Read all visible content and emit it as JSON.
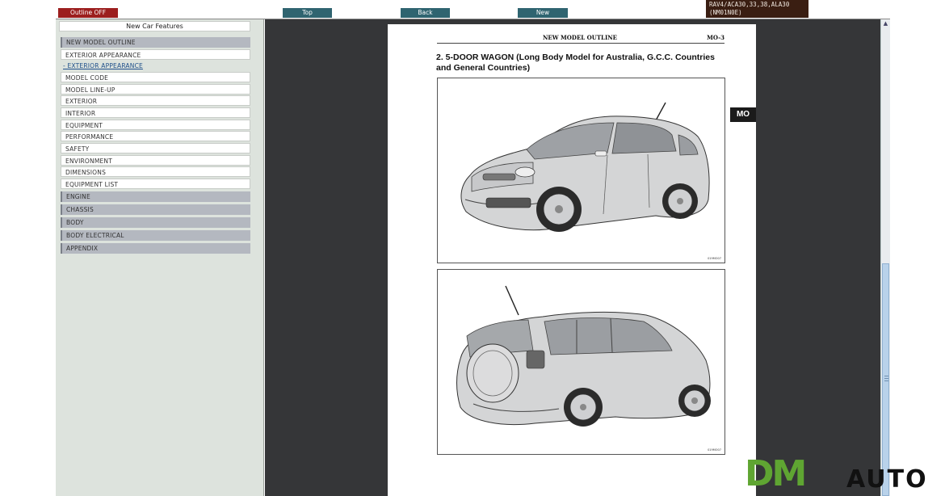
{
  "toolbar": {
    "outline_label": "Outline OFF",
    "top_label": "Top",
    "back_label": "Back",
    "new_label": "New",
    "model_line1": "RAV4/ACA30,33,38,ALA30",
    "model_line2": "(NM01N0E)"
  },
  "sidebar": {
    "header": "New Car Features",
    "items": [
      {
        "label": "NEW MODEL OUTLINE",
        "kind": "section"
      },
      {
        "label": "EXTERIOR APPEARANCE",
        "kind": "sub"
      },
      {
        "label": "- EXTERIOR APPEARANCE",
        "kind": "link"
      },
      {
        "label": "MODEL CODE",
        "kind": "sub"
      },
      {
        "label": "MODEL LINE-UP",
        "kind": "sub"
      },
      {
        "label": "EXTERIOR",
        "kind": "sub"
      },
      {
        "label": "INTERIOR",
        "kind": "sub"
      },
      {
        "label": "EQUIPMENT",
        "kind": "sub"
      },
      {
        "label": "PERFORMANCE",
        "kind": "sub"
      },
      {
        "label": "SAFETY",
        "kind": "sub"
      },
      {
        "label": "ENVIRONMENT",
        "kind": "sub"
      },
      {
        "label": "DIMENSIONS",
        "kind": "sub"
      },
      {
        "label": "EQUIPMENT LIST",
        "kind": "sub"
      },
      {
        "label": "ENGINE",
        "kind": "section"
      },
      {
        "label": "CHASSIS",
        "kind": "section"
      },
      {
        "label": "BODY",
        "kind": "section"
      },
      {
        "label": "BODY ELECTRICAL",
        "kind": "section"
      },
      {
        "label": "APPENDIX",
        "kind": "section"
      }
    ]
  },
  "document": {
    "header_title": "NEW MODEL OUTLINE",
    "page_number": "MO-3",
    "heading": "2. 5-DOOR WAGON (Long Body Model for Australia, G.C.C. Countries and General Countries)",
    "fig1_code": "019MO07",
    "fig2_code": "019MO07",
    "tab_label": "MO"
  },
  "watermark": {
    "brand_left": "DM",
    "brand_right": "AUTO"
  },
  "colors": {
    "outline_button": "#9c1e1e",
    "nav_button": "#2f6470",
    "content_bg": "#353638",
    "sidebar_bg": "#dde3dd",
    "logo_green": "#5fa532"
  },
  "icons": {
    "scroll_up": "chevron-up-icon",
    "scroll_thumb": "scroll-thumb"
  }
}
